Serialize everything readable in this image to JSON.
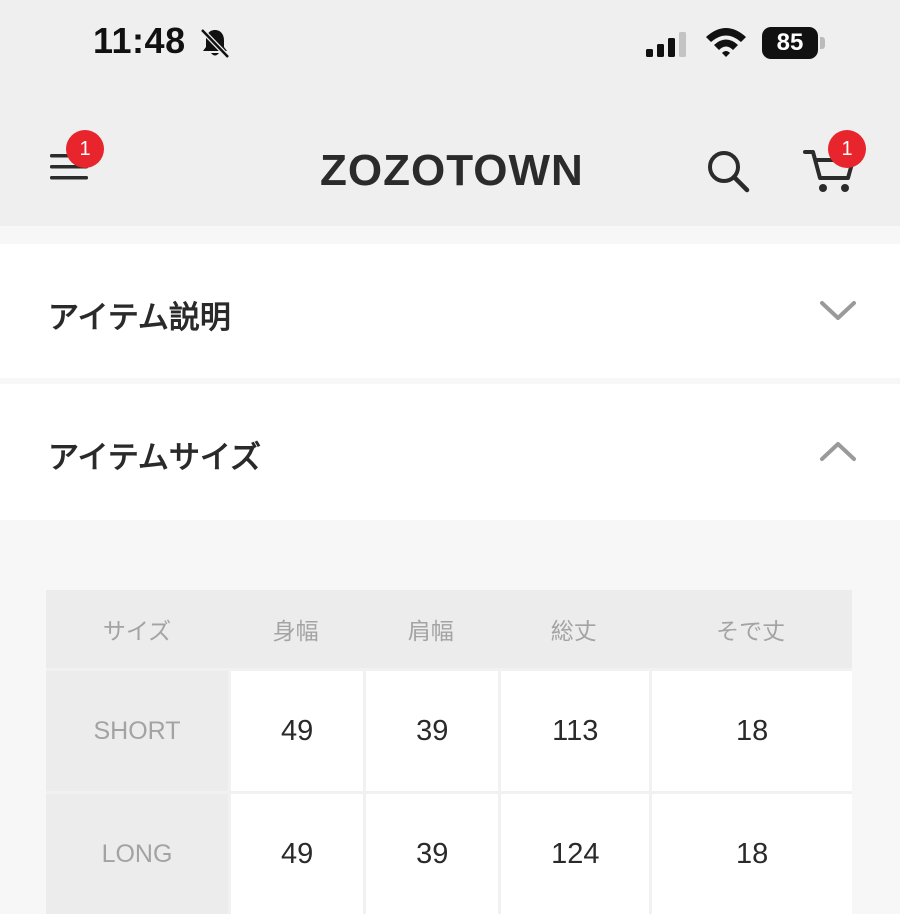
{
  "status_bar": {
    "time": "11:48",
    "battery": "85"
  },
  "header": {
    "logo": "ZOZOTOWN",
    "menu_badge": "1",
    "cart_badge": "1"
  },
  "sections": {
    "description_title": "アイテム説明",
    "size_title": "アイテムサイズ"
  },
  "size_table": {
    "headers": [
      "サイズ",
      "身幅",
      "肩幅",
      "総丈",
      "そで丈"
    ],
    "rows": [
      [
        "SHORT",
        "49",
        "39",
        "113",
        "18"
      ],
      [
        "LONG",
        "49",
        "39",
        "124",
        "18"
      ]
    ]
  },
  "icons": {
    "status": [
      "bell-slash-icon",
      "signal-icon",
      "wifi-icon",
      "battery-icon"
    ],
    "header": [
      "hamburger-menu-icon",
      "search-icon",
      "cart-icon"
    ],
    "accordion": [
      "chevron-down-icon",
      "chevron-up-icon"
    ]
  }
}
